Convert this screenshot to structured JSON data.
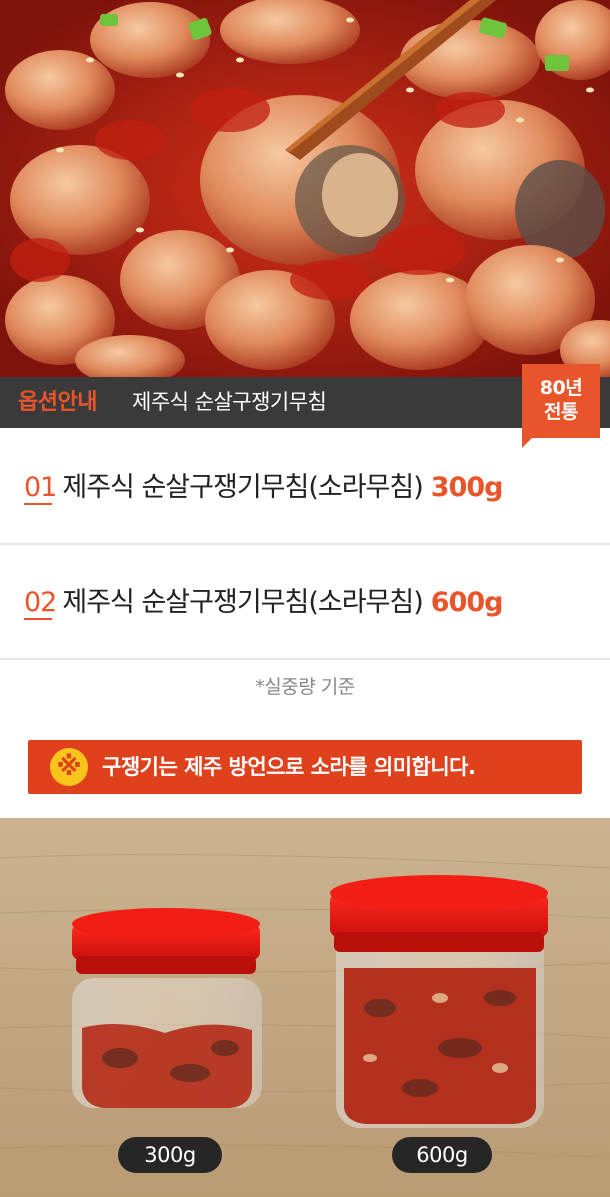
{
  "header": {
    "tag": "옵션안내",
    "title": "제주식 순살구쟁기무침",
    "badge_line1": "80년",
    "badge_line2": "전통"
  },
  "options": [
    {
      "number": "01",
      "name": "제주식 순살구쟁기무침(소라무침)",
      "weight": "300g"
    },
    {
      "number": "02",
      "name": "제주식 순살구쟁기무침(소라무침)",
      "weight": "600g"
    }
  ],
  "note": "*실중량 기준",
  "notice": {
    "icon": "reference-mark-icon",
    "icon_glyph": "※",
    "text": "구쟁기는 제주 방언으로 소라를 의미합니다."
  },
  "jars": {
    "small_label": "300g",
    "large_label": "600g"
  },
  "colors": {
    "accent": "#e9552b",
    "header_bar": "#3a3a3a",
    "notice_bg": "#e0411d",
    "notice_icon": "#f8c51c"
  }
}
